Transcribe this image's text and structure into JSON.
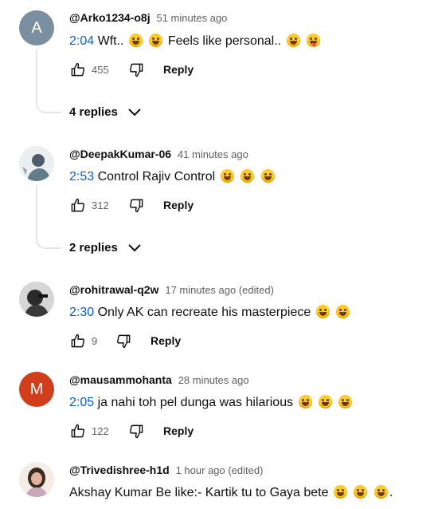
{
  "comments": [
    {
      "avatar_letter": "A",
      "avatar_color": "#7a8fa0",
      "handle": "@Arko1234-o8j",
      "time": "51 minutes ago",
      "timestamp": "2:04",
      "text_before": " Wft..",
      "text_mid": " Feels like personal..",
      "likes": "455",
      "reply_label": "Reply",
      "replies_label": "4 replies"
    },
    {
      "handle": "@DeepakKumar-06",
      "time": "41 minutes ago",
      "timestamp": "2:53",
      "text": " Control Rajiv Control",
      "likes": "312",
      "reply_label": "Reply",
      "replies_label": "2 replies"
    },
    {
      "handle": "@rohitrawal-q2w",
      "time": "17 minutes ago (edited)",
      "timestamp": "2:30",
      "text": " Only AK can recreate his  masterpiece",
      "likes": "9",
      "reply_label": "Reply"
    },
    {
      "avatar_letter": "M",
      "avatar_color": "#d03e1c",
      "handle": "@mausammohanta",
      "time": "28 minutes ago",
      "timestamp": "2:05",
      "text": " ja nahi toh pel dunga was hilarious",
      "likes": "122",
      "reply_label": "Reply"
    },
    {
      "handle": "@Trivedishree-h1d",
      "time": "1 hour ago (edited)",
      "text": "Akshay Kumar Be like:- Kartik tu to Gaya bete",
      "text_end": "."
    }
  ],
  "icons": {
    "like": "thumb-up-icon",
    "dislike": "thumb-down-icon",
    "expand": "chevron-down-icon",
    "emoji": "laughing-emoji-icon"
  }
}
